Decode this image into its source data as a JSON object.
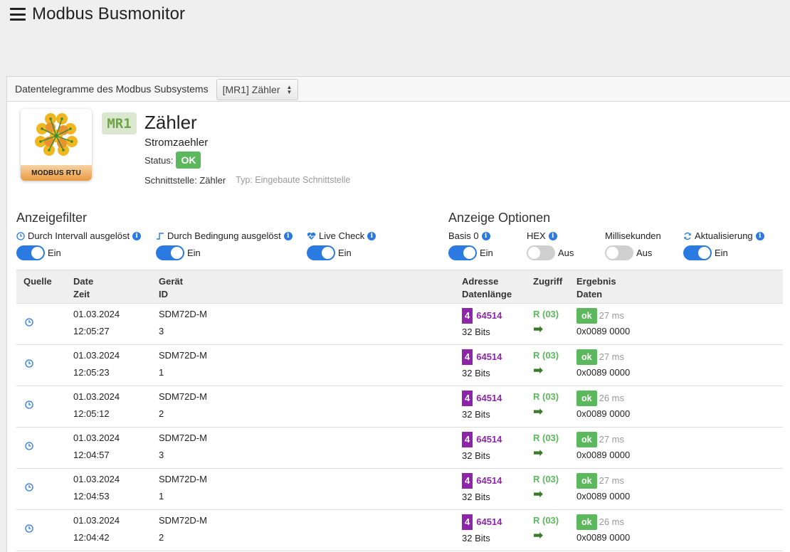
{
  "app": {
    "title": "Modbus Busmonitor"
  },
  "panel": {
    "header": "Datentelegramme des Modbus Subsystems",
    "subsystem_select": "[MR1] Zähler"
  },
  "device": {
    "logo_text": "MODBUS RTU",
    "badge": "MR1",
    "name": "Zähler",
    "subtitle": "Stromzaehler",
    "status_label": "Status:",
    "status_value": "OK",
    "interface": "Schnittstelle: Zähler",
    "interface_type": "Typ: Eingebaute Schnittstelle"
  },
  "filters": {
    "title": "Anzeigefilter",
    "items": [
      {
        "label": "Durch Intervall ausgelöst",
        "icon": "clock-icon",
        "state": "Ein"
      },
      {
        "label": "Durch Bedingung ausgelöst",
        "icon": "step-signal-icon",
        "state": "Ein"
      },
      {
        "label": "Live Check",
        "icon": "heartbeat-icon",
        "state": "Ein"
      }
    ]
  },
  "options": {
    "title": "Anzeige Optionen",
    "items": [
      {
        "label": "Basis 0",
        "state": "Ein",
        "info": true
      },
      {
        "label": "HEX",
        "state": "Aus",
        "info": true
      },
      {
        "label": "Millisekunden",
        "state": "Aus",
        "info": false
      },
      {
        "label": "Aktualisierung",
        "state": "Ein",
        "info": true,
        "icon": "refresh-icon"
      }
    ]
  },
  "table": {
    "headers": {
      "source": "Quelle",
      "date": "Date",
      "time": "Zeit",
      "device": "Gerät",
      "id": "ID",
      "address": "Adresse",
      "length": "Datenlänge",
      "access": "Zugriff",
      "result": "Ergebnis",
      "data": "Daten"
    },
    "rows": [
      {
        "date": "01.03.2024",
        "time": "12:05:27",
        "device": "SDM72D-M",
        "id": "3",
        "addr_num": "4",
        "addr": "64514",
        "length": "32 Bits",
        "access": "R (03)",
        "result": "ok",
        "ms": "27 ms",
        "data": "0x0089 0000"
      },
      {
        "date": "01.03.2024",
        "time": "12:05:23",
        "device": "SDM72D-M",
        "id": "1",
        "addr_num": "4",
        "addr": "64514",
        "length": "32 Bits",
        "access": "R (03)",
        "result": "ok",
        "ms": "27 ms",
        "data": "0x0089 0000"
      },
      {
        "date": "01.03.2024",
        "time": "12:05:12",
        "device": "SDM72D-M",
        "id": "2",
        "addr_num": "4",
        "addr": "64514",
        "length": "32 Bits",
        "access": "R (03)",
        "result": "ok",
        "ms": "26 ms",
        "data": "0x0089 0000"
      },
      {
        "date": "01.03.2024",
        "time": "12:04:57",
        "device": "SDM72D-M",
        "id": "3",
        "addr_num": "4",
        "addr": "64514",
        "length": "32 Bits",
        "access": "R (03)",
        "result": "ok",
        "ms": "27 ms",
        "data": "0x0089 0000"
      },
      {
        "date": "01.03.2024",
        "time": "12:04:53",
        "device": "SDM72D-M",
        "id": "1",
        "addr_num": "4",
        "addr": "64514",
        "length": "32 Bits",
        "access": "R (03)",
        "result": "ok",
        "ms": "27 ms",
        "data": "0x0089 0000"
      },
      {
        "date": "01.03.2024",
        "time": "12:04:42",
        "device": "SDM72D-M",
        "id": "2",
        "addr_num": "4",
        "addr": "64514",
        "length": "32 Bits",
        "access": "R (03)",
        "result": "ok",
        "ms": "26 ms",
        "data": "0x0089 0000"
      }
    ]
  },
  "colors": {
    "accent": "#2a7ae2",
    "ok": "#5cb85c",
    "address": "#8e24aa",
    "badge_bg": "#dbe8cf"
  }
}
